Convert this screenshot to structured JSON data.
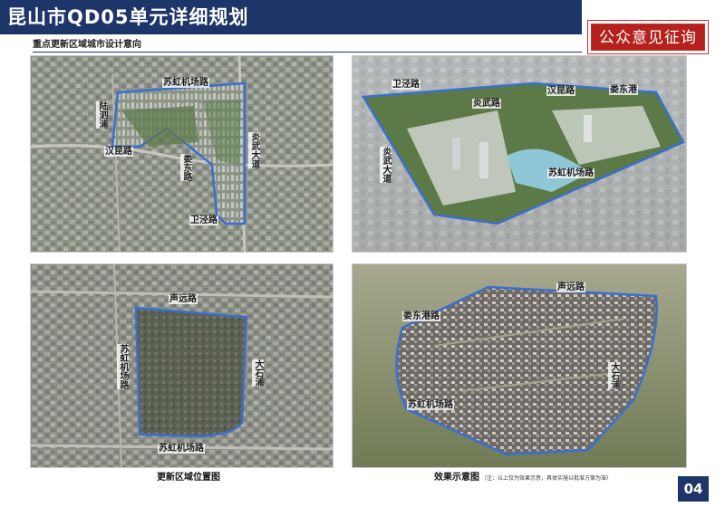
{
  "header": {
    "title": "昆山市QD05单元详细规划",
    "notice": "公众意见征询"
  },
  "subtitle": "重点更新区域城市设计意向",
  "panels": {
    "top_left": {
      "roads": [
        "苏虹机场路",
        "陆泗浦",
        "汉昆路",
        "炎武大道",
        "娄东路",
        "卫泾路"
      ]
    },
    "top_right": {
      "roads": [
        "卫泾路",
        "炎武路",
        "汉昆路",
        "娄东港",
        "炎武大道",
        "苏虹机场路"
      ]
    },
    "bottom_left": {
      "roads": [
        "声远路",
        "大石浦",
        "苏虹机场路",
        "苏虹机场路"
      ]
    },
    "bottom_right": {
      "roads": [
        "声远路",
        "娄东港路",
        "大石浦",
        "苏虹机场路"
      ]
    }
  },
  "captions": {
    "left": "更新区域位置图",
    "right": "效果示意图",
    "right_note": "（注：以上仅为效果示意，具体实施以批准方案为准）"
  },
  "page_number": "04",
  "colors": {
    "header_bg": "#1e3569",
    "notice_red": "#b5221d",
    "boundary_blue": "#3a6fd0"
  }
}
